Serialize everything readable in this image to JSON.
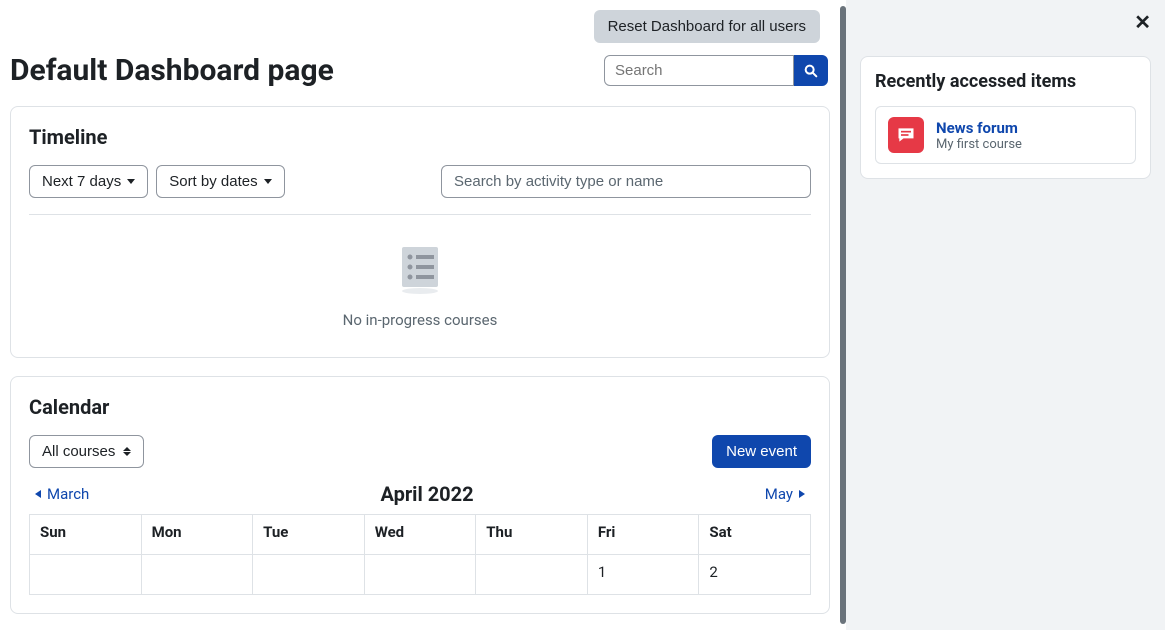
{
  "header": {
    "reset_label": "Reset Dashboard for all users",
    "page_title": "Default Dashboard page",
    "search_placeholder": "Search"
  },
  "timeline": {
    "heading": "Timeline",
    "filter_range": "Next 7 days",
    "sort_by": "Sort by dates",
    "search_placeholder": "Search by activity type or name",
    "empty_message": "No in-progress courses"
  },
  "calendar": {
    "heading": "Calendar",
    "course_filter": "All courses",
    "new_event_label": "New event",
    "prev_month": "March",
    "current_month": "April 2022",
    "next_month": "May",
    "day_headers": [
      "Sun",
      "Mon",
      "Tue",
      "Wed",
      "Thu",
      "Fri",
      "Sat"
    ],
    "first_row": [
      "",
      "",
      "",
      "",
      "",
      "1",
      "2"
    ]
  },
  "drawer": {
    "heading": "Recently accessed items",
    "items": [
      {
        "title": "News forum",
        "subtitle": "My first course",
        "icon": "forum-icon"
      }
    ]
  }
}
